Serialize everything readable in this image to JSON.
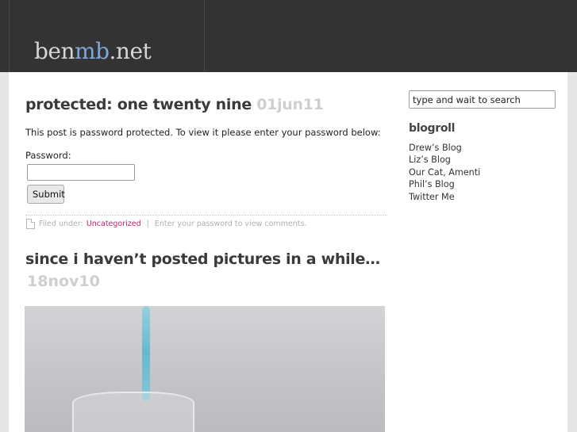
{
  "site": {
    "logo_prefix": "ben",
    "logo_accent": "mb",
    "logo_suffix": ".net",
    "accent_color": "#7fa8d8"
  },
  "post1": {
    "title": "protected: one twenty nine",
    "date": "01jun11",
    "body": "This post is password protected. To view it please enter your password below:",
    "password_label": "Password:",
    "password_value": "",
    "submit_label": "Submit",
    "meta_prefix": "Filed under:",
    "category": "Uncategorized",
    "meta_separator": "|",
    "comments_text": "Enter your password to view comments."
  },
  "post2": {
    "title": "since i haven’t posted pictures in a while…",
    "date": "18nov10"
  },
  "sidebar": {
    "search_placeholder": "type and wait to search",
    "blogroll_title": "blogroll",
    "blogroll_items": [
      {
        "label": "Drew’s Blog"
      },
      {
        "label": "Liz’s Blog"
      },
      {
        "label": "Our Cat, Amenti"
      },
      {
        "label": "Phil’s Blog"
      },
      {
        "label": "Twitter Me"
      }
    ]
  },
  "colors": {
    "topbar": "#333333",
    "category_link": "#c0226a",
    "date_grey": "#cfcfcf"
  }
}
